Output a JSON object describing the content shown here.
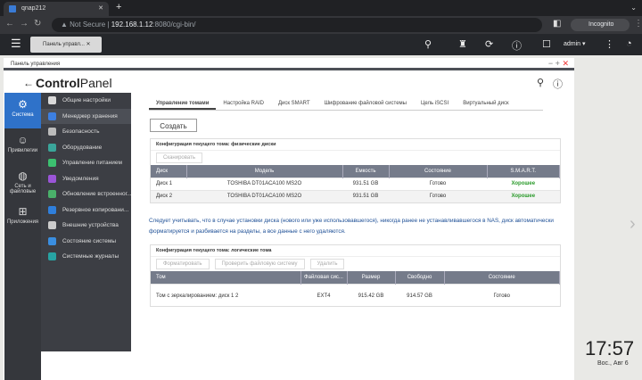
{
  "browser": {
    "tab_title": "qnap212",
    "new_tab": "+",
    "address_prefix": "Not Secure",
    "address_host": "192.168.1.12",
    "address_rest": ":8080/cgi-bin/",
    "profile": "Incognito"
  },
  "qnap_bar": {
    "app_tab": "Панель управл...",
    "user": "admin"
  },
  "window": {
    "title": "Панель управления",
    "logo_bold": "Control",
    "logo_light": "Panel"
  },
  "icon_col": [
    {
      "label": "Система",
      "icon": "gear-icon"
    },
    {
      "label": "Привилегии",
      "icon": "user-icon"
    },
    {
      "label": "Сеть и файловые",
      "icon": "globe-icon"
    },
    {
      "label": "Приложения",
      "icon": "apps-icon"
    }
  ],
  "sub_menu": [
    {
      "label": "Общие настройки",
      "color": "#d9d9d9"
    },
    {
      "label": "Менеджер хранения",
      "color": "#3d7fe0"
    },
    {
      "label": "Безопасность",
      "color": "#bbbbbb"
    },
    {
      "label": "Оборудование",
      "color": "#3aa59a"
    },
    {
      "label": "Управление питанием",
      "color": "#3cc070"
    },
    {
      "label": "Уведомления",
      "color": "#9b55d8"
    },
    {
      "label": "Обновление встроенног...",
      "color": "#4ab06a"
    },
    {
      "label": "Резервное копировани...",
      "color": "#2f7fdc"
    },
    {
      "label": "Внешние устройства",
      "color": "#cccccc"
    },
    {
      "label": "Состояние системы",
      "color": "#3a8ee0"
    },
    {
      "label": "Системные журналы",
      "color": "#27a3a3"
    }
  ],
  "tabs": [
    "Управление томами",
    "Настройка RAID",
    "Диск SMART",
    "Шифрование файловой системы",
    "Цель iSCSI",
    "Виртуальный диск"
  ],
  "create_label": "Создать",
  "physical": {
    "title": "Конфигурация текущего тома: физические диски",
    "scan": "Сканировать",
    "headers": [
      "Диск",
      "Модель",
      "Емкость",
      "Состояние",
      "S.M.A.R.T."
    ],
    "rows": [
      [
        "Диск 1",
        "TOSHIBA DT01ACA100 MS2O",
        "931.51 GB",
        "Готово",
        "Хорошее"
      ],
      [
        "Диск 2",
        "TOSHIBA DT01ACA100 MS2O",
        "931.51 GB",
        "Готово",
        "Хорошее"
      ]
    ]
  },
  "note": "Следует учитывать, что в случае установки диска (нового или уже использовавшегося), никогда ранее не устанавливавшегося в NAS, диск автоматически форматируется и разбивается на разделы, а все данные с него удаляются.",
  "logical": {
    "title": "Конфигурация текущего тома: логические тома",
    "buttons": [
      "Форматировать",
      "Проверить файловую систему",
      "Удалить"
    ],
    "headers": [
      "Том",
      "Файловая сис...",
      "Размер",
      "Свободно",
      "Состояние"
    ],
    "rows": [
      [
        "Том с зеркалированием: диск 1 2",
        "EXT4",
        "915.42 GB",
        "914.57 GB",
        "Готово"
      ]
    ]
  },
  "desktop": {
    "time": "17:57",
    "date": "Вос., Авг 6"
  }
}
